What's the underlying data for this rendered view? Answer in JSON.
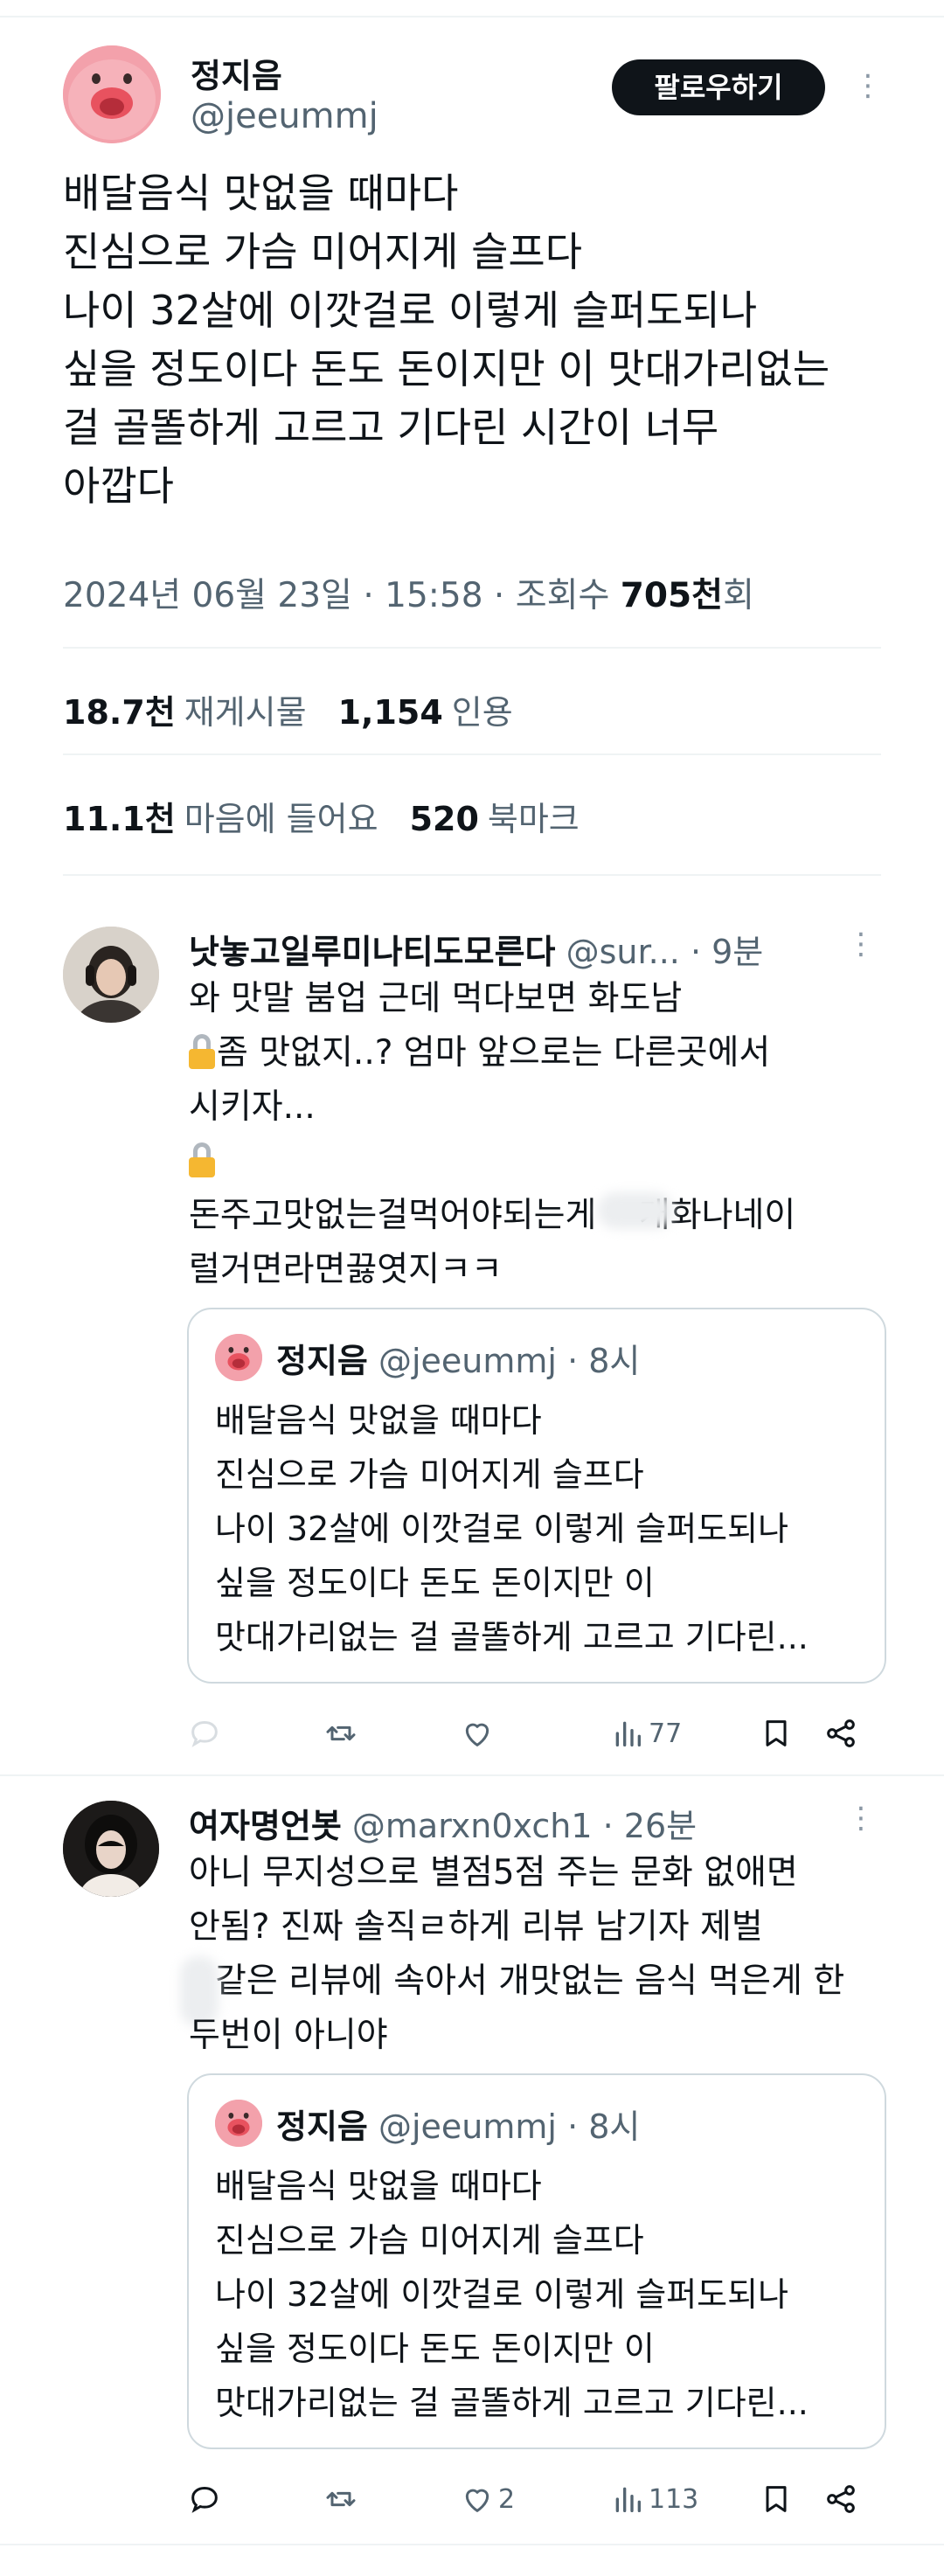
{
  "main_tweet": {
    "author_name": "정지음",
    "author_handle": "@jeeummj",
    "follow_label": "팔로우하기",
    "lines": [
      "배달음식 맛없을 때마다",
      "진심으로 가슴 미어지게 슬프다",
      "나이 32살에 이깟걸로 이렇게 슬퍼도되나",
      "싶을 정도이다 돈도 돈이지만 이 맛대가리없는",
      "걸 골똘하게 고르고 기다린 시간이 너무",
      "아깝다"
    ],
    "timestamp": "2024년 06월 23일 · 15:58",
    "views_label": " · 조회수 ",
    "views_count": "705천",
    "views_suffix": "회",
    "retweets": "18.7천",
    "retweets_label": "재게시물",
    "quotes": "1,154",
    "quotes_label": "인용",
    "likes": "11.1천",
    "likes_label": "마음에 들어요",
    "bookmarks": "520",
    "bookmarks_label": "북마크"
  },
  "replies": [
    {
      "name": "낫놓고일루미나티도모른다",
      "handle": "@sur...",
      "time": " · 9분",
      "line1": "와 맛말 붐업 근데 먹다보면 화도남",
      "line2": "좀 맛없지..? 엄마 앞으로는 다른곳에서",
      "line3": "시키자...",
      "line5": "돈주고맛없는걸먹어야되는게 ",
      "line5b": "개화나네이",
      "line6": "럴거면라면끓엿지ㅋㅋ",
      "quote": {
        "name": "정지음",
        "handle": "@jeeummj",
        "time": " · 8시",
        "lines": [
          "배달음식 맛없을 때마다",
          "진심으로 가슴 미어지게 슬프다",
          "나이 32살에 이깟걸로 이렇게 슬퍼도되나",
          "싶을 정도이다 돈도 돈이지만 이",
          "맛대가리없는 걸 골똘하게 고르고 기다린..."
        ]
      },
      "views": "77",
      "likes": ""
    },
    {
      "name": "여자명언봇",
      "handle": "@marxn0xch1",
      "time": " · 26분",
      "line1": "아니 무지성으로 별점5점 주는 문화 없애면",
      "line2": "안됨? 진짜 솔직ㄹ하게 리뷰 남기자 제벌",
      "line3": "같은 리뷰에 속아서 개맛없는 음식 먹은게 한",
      "line4": "두번이 아니야",
      "quote": {
        "name": "정지음",
        "handle": "@jeeummj",
        "time": " · 8시",
        "lines": [
          "배달음식 맛없을 때마다",
          "진심으로 가슴 미어지게 슬프다",
          "나이 32살에 이깟걸로 이렇게 슬퍼도되나",
          "싶을 정도이다 돈도 돈이지만 이",
          "맛대가리없는 걸 골똘하게 고르고 기다린..."
        ]
      },
      "views": "113",
      "likes": "2"
    }
  ],
  "colors": {
    "text": "#0f1419",
    "muted": "#536471",
    "border": "#cfd9de",
    "divider": "#eff3f4",
    "follow_bg": "#0f1419",
    "avatar_pink": "#f4a7b0"
  }
}
